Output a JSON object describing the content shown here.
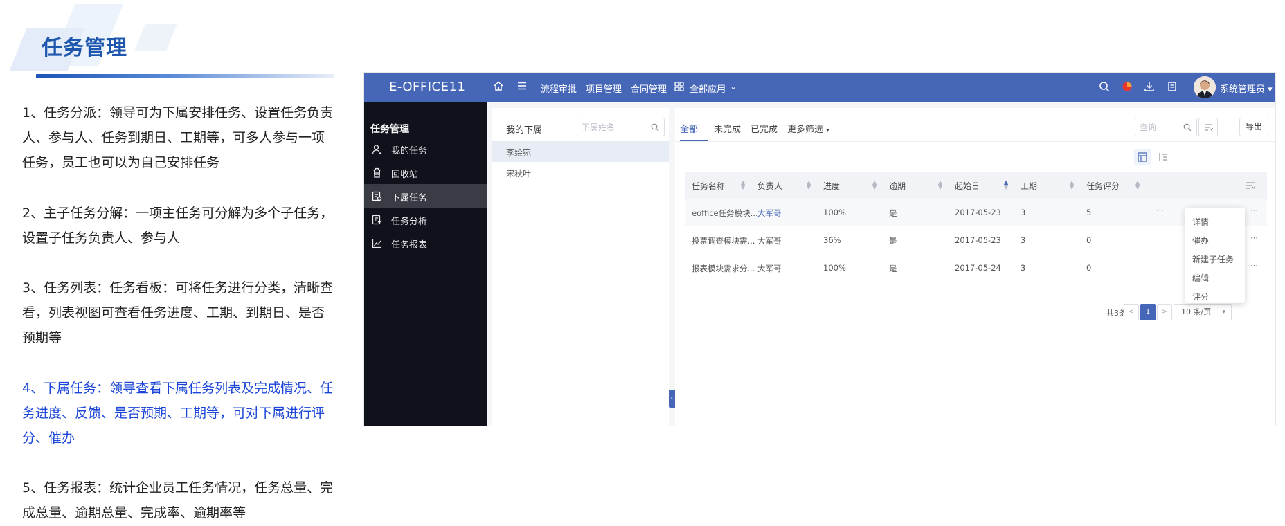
{
  "slide": {
    "title": "任务管理",
    "points": [
      "1、任务分派：领导可为下属安排任务、设置任务负责人、参与人、任务到期日、工期等，可多人参与一项任务，员工也可以为自己安排任务",
      "2、主子任务分解：一项主任务可分解为多个子任务，设置子任务负责人、参与人",
      "3、任务列表：任务看板：可将任务进行分类，清晰查看，列表视图可查看任务进度、工期、到期日、是否预期等",
      "4、下属任务：领导查看下属任务列表及完成情况、任务进度、反馈、是否预期、工期等，可对下属进行评分、催办",
      "5、任务报表：统计企业员工任务情况，任务总量、完成总量、逾期总量、完成率、逾期率等"
    ],
    "highlight_color": "#1a45d8",
    "title_color": "#1e56ad"
  },
  "app": {
    "brand": "E-OFFICE11",
    "topnav": [
      "流程审批",
      "项目管理",
      "合同管理"
    ],
    "all_apps": "全部应用",
    "user": "系统管理员",
    "accent": "#4667b7",
    "sidebar": {
      "title": "任务管理",
      "items": [
        {
          "label": "我的任务",
          "icon": "user-icon"
        },
        {
          "label": "回收站",
          "icon": "trash-icon"
        },
        {
          "label": "下属任务",
          "icon": "subordinate-task-icon",
          "active": true
        },
        {
          "label": "任务分析",
          "icon": "analysis-icon"
        },
        {
          "label": "任务报表",
          "icon": "chart-line-icon"
        }
      ]
    },
    "subordinates": {
      "title": "我的下属",
      "search_placeholder": "下属姓名",
      "people": [
        "李绘宛",
        "宋秋叶"
      ]
    },
    "tabs": [
      "全部",
      "未完成",
      "已完成",
      "更多筛选"
    ],
    "search_placeholder": "查询",
    "export_label": "导出",
    "table": {
      "headers": [
        "任务名称",
        "负责人",
        "进度",
        "逾期",
        "起始日",
        "工期",
        "任务评分"
      ],
      "rows": [
        [
          "eoffice任务模块...",
          "大军哥",
          "100%",
          "是",
          "2017-05-23",
          "3",
          "5"
        ],
        [
          "投票调查模块需...",
          "大军哥",
          "36%",
          "是",
          "2017-05-23",
          "3",
          "0"
        ],
        [
          "报表模块需求分...",
          "大军哥",
          "100%",
          "是",
          "2017-05-24",
          "3",
          "0"
        ]
      ]
    },
    "pagination": {
      "total": "共3条",
      "prev": "<",
      "current": "1",
      "next": ">",
      "page_size": "10 条/页"
    },
    "row_menu": [
      "详情",
      "催办",
      "新建子任务",
      "编辑",
      "评分"
    ]
  }
}
